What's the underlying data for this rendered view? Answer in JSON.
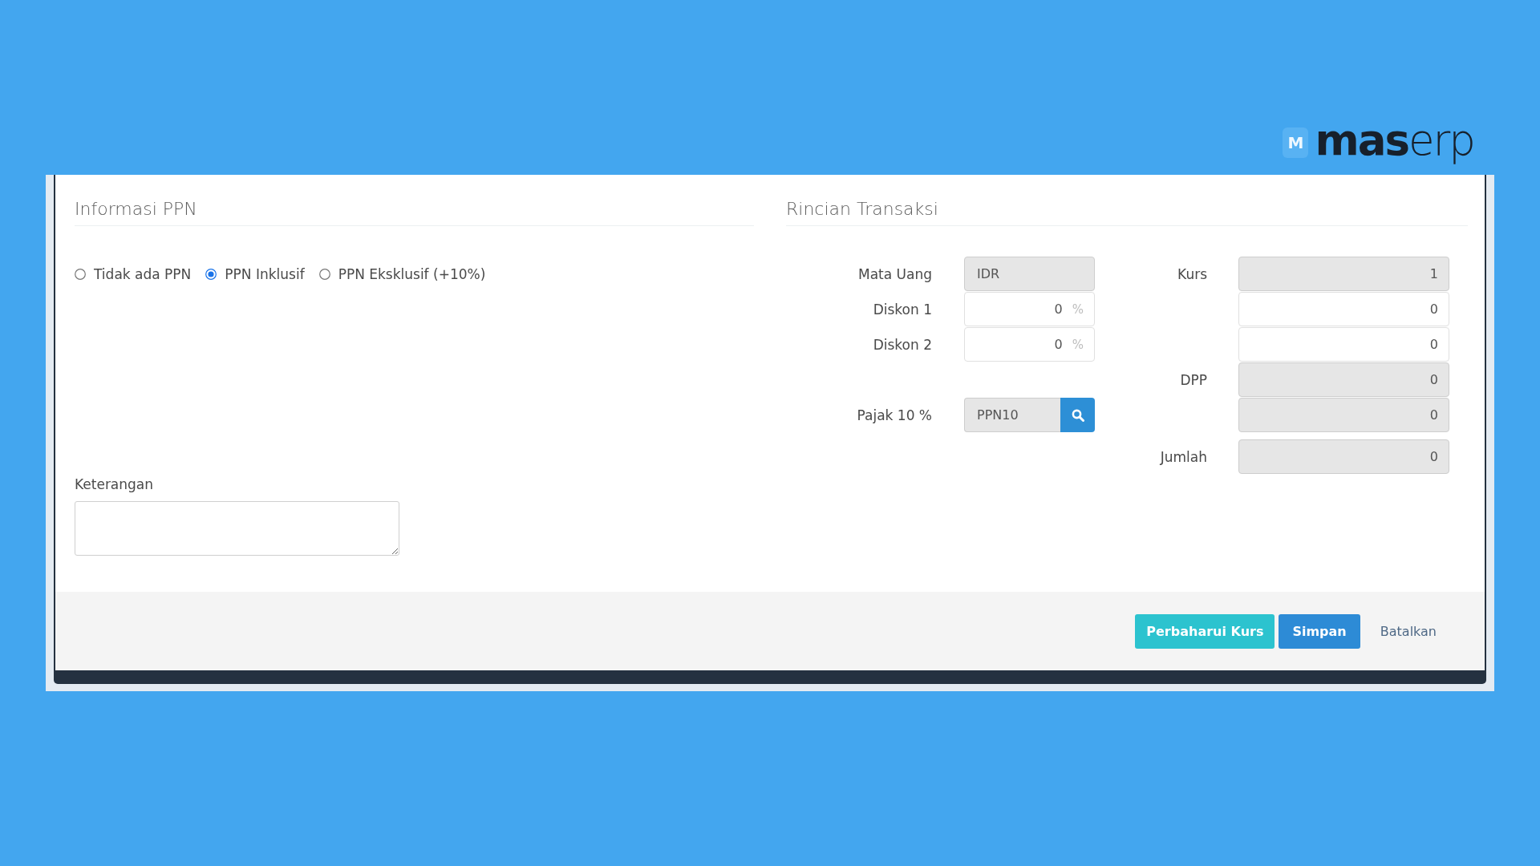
{
  "logo": {
    "mark": "M",
    "wordmark": "**mas**erp"
  },
  "ppn_info": {
    "title": "Informasi PPN",
    "options": [
      {
        "label": "Tidak ada PPN",
        "selected": false
      },
      {
        "label": "PPN Inklusif",
        "selected": true
      },
      {
        "label": "PPN Eksklusif (+10%)",
        "selected": false
      }
    ]
  },
  "notes": {
    "label": "Keterangan"
  },
  "transaction": {
    "title": "Rincian Transaksi",
    "rows": [
      {
        "left": {
          "label": "Mata Uang",
          "kind": "text",
          "value": "IDR",
          "readonly": true
        },
        "right": {
          "label": "Kurs",
          "kind": "number",
          "value": "1",
          "readonly": true
        }
      },
      {
        "left": {
          "label": "Diskon 1",
          "kind": "percent",
          "value": "0",
          "suffix": "%",
          "readonly": false
        },
        "right": {
          "kind": "number",
          "value": "0",
          "readonly": false
        }
      },
      {
        "left": {
          "label": "Diskon 2",
          "kind": "percent",
          "value": "0",
          "suffix": "%",
          "readonly": false
        },
        "right": {
          "kind": "number",
          "value": "0",
          "readonly": false
        }
      },
      {
        "right": {
          "label": "DPP",
          "kind": "number",
          "value": "0",
          "readonly": true
        }
      },
      {
        "left": {
          "label": "Pajak 10 %",
          "kind": "lookup",
          "value": "PPN10",
          "readonly": true
        },
        "right": {
          "kind": "number",
          "value": "0",
          "readonly": true
        }
      },
      {
        "right": {
          "label": "Jumlah",
          "kind": "number",
          "value": "0",
          "readonly": true
        }
      }
    ]
  },
  "actions": [
    {
      "label": "Perbaharui Kurs",
      "kind": "info"
    },
    {
      "label": "Simpan",
      "kind": "primary"
    },
    {
      "label": "Batalkan",
      "kind": "link"
    }
  ]
}
